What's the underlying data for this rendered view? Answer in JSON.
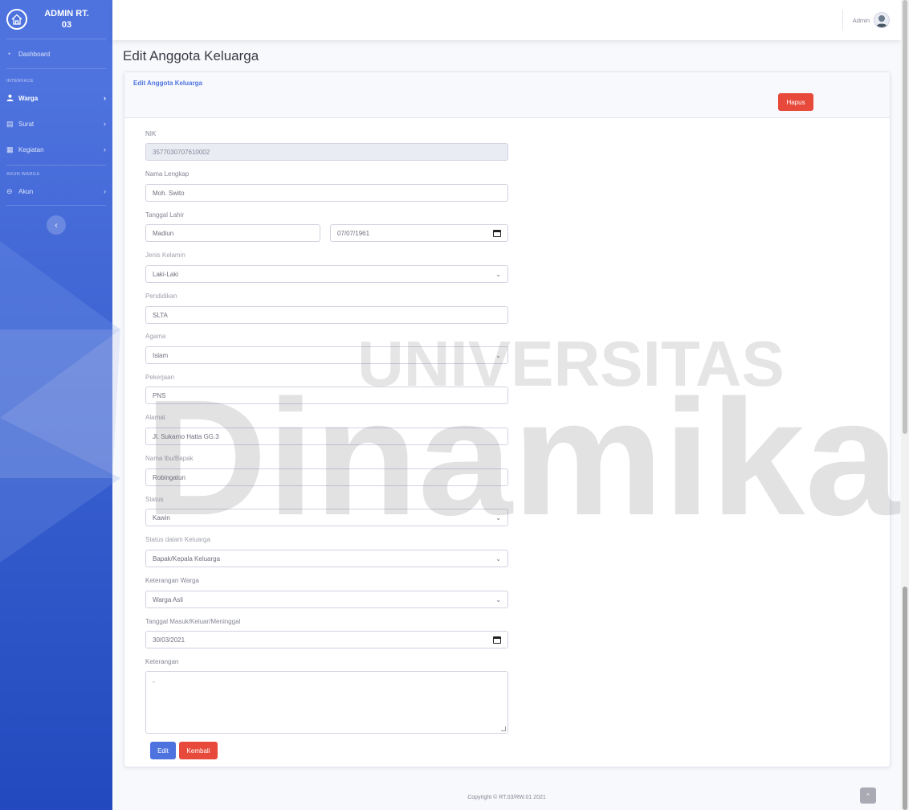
{
  "brand": {
    "line1": "ADMIN RT.",
    "line2": "03"
  },
  "sidebar": {
    "dashboard": "Dashboard",
    "heading_interface": "INTERFACE",
    "items_interface": [
      {
        "label": "Warga",
        "icon": "user-icon"
      },
      {
        "label": "Surat",
        "icon": "file-icon"
      },
      {
        "label": "Kegiatan",
        "icon": "list-icon"
      }
    ],
    "heading_akun": "AKUN WARGA",
    "akun": "Akun",
    "toggle": "‹"
  },
  "topbar": {
    "user": "Admin"
  },
  "page": {
    "title": "Edit Anggota Keluarga"
  },
  "card": {
    "header_title": "Edit Anggota Keluarga",
    "delete_label": "Hapus"
  },
  "form": {
    "nik": {
      "label": "NIK",
      "value": "3577030707610002"
    },
    "nama": {
      "label": "Nama Lengkap",
      "value": "Moh. Swito"
    },
    "ttl": {
      "label": "Tanggal Lahir",
      "place": "Madiun",
      "date": "07/07/1961"
    },
    "jk": {
      "label": "Jenis Kelamin",
      "value": "Laki-Laki"
    },
    "pendidikan": {
      "label": "Pendidikan",
      "value": "SLTA"
    },
    "agama": {
      "label": "Agama",
      "value": "Islam"
    },
    "pekerjaan": {
      "label": "Pekerjaan",
      "value": "PNS"
    },
    "alamat": {
      "label": "Alamat",
      "value": "Jl. Sukarno Hatta GG.3"
    },
    "ortu": {
      "label": "Nama Ibu/Bapak",
      "value": "Robingatun"
    },
    "status": {
      "label": "Status",
      "value": "Kawin"
    },
    "status_keluarga": {
      "label": "Status dalam Keluarga",
      "value": "Bapak/Kepala Keluarga"
    },
    "ket_warga": {
      "label": "Keterangan Warga",
      "value": "Warga Asli"
    },
    "tgl_masuk": {
      "label": "Tanggal Masuk/Keluar/Meninggal",
      "value": "30/03/2021"
    },
    "keterangan": {
      "label": "Keterangan",
      "value": "-"
    },
    "edit_label": "Edit",
    "back_label": "Kembali"
  },
  "footer": {
    "copyright": "Copyright © RT.03/RW.01 2021",
    "scroll_top": "^"
  },
  "watermark": {
    "line1": "UNIVERSITAS",
    "line2": "Dinamika"
  },
  "colors": {
    "primary": "#4e73df",
    "danger": "#e74a3b",
    "sidebar_dark": "#224abe"
  }
}
